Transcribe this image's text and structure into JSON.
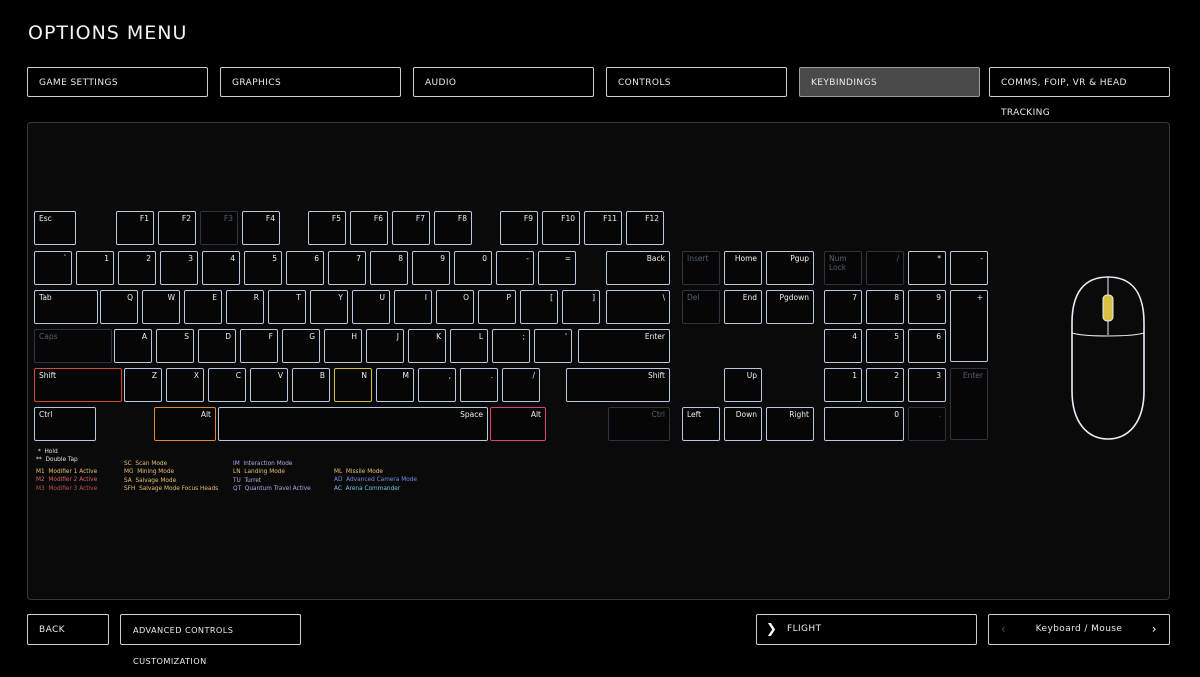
{
  "title": "OPTIONS MENU",
  "tabs": [
    {
      "label": "GAME SETTINGS",
      "active": false
    },
    {
      "label": "GRAPHICS",
      "active": false
    },
    {
      "label": "AUDIO",
      "active": false
    },
    {
      "label": "CONTROLS",
      "active": false
    },
    {
      "label": "KEYBINDINGS",
      "active": true
    },
    {
      "label": "COMMS, FOIP, VR & HEAD TRACKING",
      "active": false
    }
  ],
  "keys": {
    "esc": "Esc",
    "f1": "F1",
    "f2": "F2",
    "f3": "F3",
    "f4": "F4",
    "f5": "F5",
    "f6": "F6",
    "f7": "F7",
    "f8": "F8",
    "f9": "F9",
    "f10": "F10",
    "f11": "F11",
    "f12": "F12",
    "grave": "`",
    "n1": "1",
    "n2": "2",
    "n3": "3",
    "n4": "4",
    "n5": "5",
    "n6": "6",
    "n7": "7",
    "n8": "8",
    "n9": "9",
    "n0": "0",
    "minus": "-",
    "equals": "=",
    "back": "Back",
    "tab": "Tab",
    "q": "Q",
    "w": "W",
    "e": "E",
    "r": "R",
    "t": "T",
    "y": "Y",
    "u": "U",
    "i": "I",
    "o": "O",
    "p": "P",
    "lbr": "[",
    "rbr": "]",
    "bslash": "\\",
    "caps": "Caps",
    "a": "A",
    "s": "S",
    "d": "D",
    "f": "F",
    "g": "G",
    "h": "H",
    "j": "J",
    "k": "K",
    "l": "L",
    "semi": ";",
    "quote": "'",
    "enter": "Enter",
    "lshift": "Shift",
    "z": "Z",
    "x": "X",
    "c": "C",
    "v": "V",
    "b": "B",
    "n": "N",
    "m": "M",
    "comma": ",",
    "period": ".",
    "slash": "/",
    "rshift": "Shift",
    "lctrl": "Ctrl",
    "lalt": "Alt",
    "space": "Space",
    "ralt": "Alt",
    "rctrl": "Ctrl",
    "insert": "Insert",
    "home": "Home",
    "pgup": "Pgup",
    "del": "Del",
    "end": "End",
    "pgdown": "Pgdown",
    "up": "Up",
    "left": "Left",
    "down": "Down",
    "right": "Right",
    "numlock": "Num Lock",
    "npslash": "/",
    "npstar": "*",
    "npminus": "-",
    "np7": "7",
    "np8": "8",
    "np9": "9",
    "npplus": "+",
    "np4": "4",
    "np5": "5",
    "np6": "6",
    "np1": "1",
    "np2": "2",
    "np3": "3",
    "npenter": "Enter",
    "np0": "0",
    "npdot": "."
  },
  "legend": {
    "hold": "Hold",
    "double_tap": "Double Tap",
    "modifiers": [
      {
        "code": "M1",
        "label": "Modifier 1 Active"
      },
      {
        "code": "M2",
        "label": "Modifier 2 Active"
      },
      {
        "code": "M3",
        "label": "Modifier 3 Active"
      }
    ],
    "modes_a": [
      {
        "code": "SC",
        "label": "Scan Mode"
      },
      {
        "code": "MG",
        "label": "Mining Mode"
      },
      {
        "code": "SA",
        "label": "Salvage Mode"
      },
      {
        "code": "SFH",
        "label": "Salvage Mode Focus Heads"
      }
    ],
    "modes_b": [
      {
        "code": "IM",
        "label": "Interaction Mode"
      },
      {
        "code": "LN",
        "label": "Landing Mode"
      },
      {
        "code": "TU",
        "label": "Turret"
      },
      {
        "code": "QT",
        "label": "Quantum Travel Active"
      }
    ],
    "modes_c": [
      {
        "code": "ML",
        "label": "Missile Mode"
      },
      {
        "code": "AD",
        "label": "Advanced Camera Mode"
      },
      {
        "code": "AC",
        "label": "Arena Commander"
      }
    ]
  },
  "buttons": {
    "back": "BACK",
    "advanced": "ADVANCED CONTROLS CUSTOMIZATION",
    "flight": "FLIGHT",
    "device": "Keyboard / Mouse"
  },
  "colors": {
    "accent_red": "#d34a2c",
    "accent_orange": "#e08a2c",
    "accent_pink": "#e0407a",
    "active_tab": "#4a4a4a"
  }
}
